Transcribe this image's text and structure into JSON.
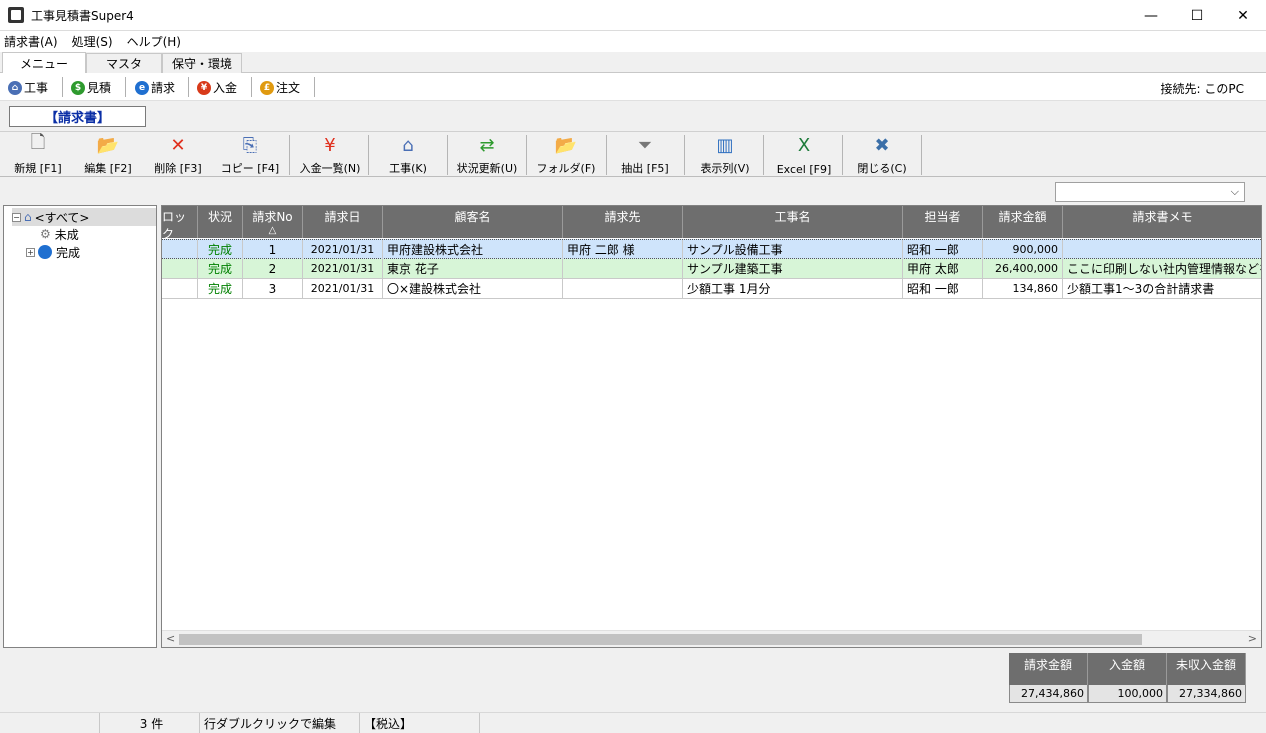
{
  "window": {
    "title": "工事見積書Super4",
    "minimize": "—",
    "maximize": "☐",
    "close": "✕"
  },
  "menu": [
    "請求書(A)",
    "処理(S)",
    "ヘルプ(H)"
  ],
  "tabs": [
    "メニュー",
    "マスタ",
    "保守・環境"
  ],
  "quick_nav": [
    {
      "label": "工事",
      "glyph": "⌂",
      "color": "#4a6fb5"
    },
    {
      "label": "見積",
      "glyph": "$",
      "color": "#2e9a2e"
    },
    {
      "label": "請求",
      "glyph": "e",
      "color": "#1f6fd0"
    },
    {
      "label": "入金",
      "glyph": "¥",
      "color": "#d83a1a"
    },
    {
      "label": "注文",
      "glyph": "£",
      "color": "#e09a10"
    }
  ],
  "connection": "接続先:  このPC",
  "section_title": "【請求書】",
  "toolbar": [
    {
      "label": "新規 [F1]",
      "glyph": "🗋",
      "color": "#555"
    },
    {
      "label": "編集 [F2]",
      "glyph": "📂",
      "color": "#d6a51a"
    },
    {
      "label": "削除 [F3]",
      "glyph": "✕",
      "color": "#e0301e"
    },
    {
      "label": "コピー [F4]",
      "glyph": "⎘",
      "color": "#4a6fb5"
    },
    {
      "label": "入金一覧(N)",
      "glyph": "¥",
      "color": "#e0301e"
    },
    {
      "label": "工事(K)",
      "glyph": "⌂",
      "color": "#4a6fb5"
    },
    {
      "label": "状況更新(U)",
      "glyph": "⇄",
      "color": "#2e9a2e"
    },
    {
      "label": "フォルダ(F)",
      "glyph": "📂",
      "color": "#d6a51a"
    },
    {
      "label": "抽出 [F5]",
      "glyph": "⏷",
      "color": "#777"
    },
    {
      "label": "表示列(V)",
      "glyph": "▥",
      "color": "#2e6fc0"
    },
    {
      "label": "Excel [F9]",
      "glyph": "X",
      "color": "#1d7b3a"
    },
    {
      "label": "閉じる(C)",
      "glyph": "✖",
      "color": "#3b6fa8"
    }
  ],
  "filter_combo": {
    "value": ""
  },
  "tree": [
    {
      "label": "<すべて>",
      "expander": "−",
      "selected": true
    },
    {
      "label": "未成",
      "expander": "",
      "selected": false
    },
    {
      "label": "完成",
      "expander": "+",
      "selected": false
    }
  ],
  "grid": {
    "columns": [
      {
        "label": "ロック",
        "sub": ""
      },
      {
        "label": "状況",
        "sub": ""
      },
      {
        "label": "請求No",
        "sub": "△"
      },
      {
        "label": "請求日",
        "sub": ""
      },
      {
        "label": "顧客名",
        "sub": ""
      },
      {
        "label": "請求先",
        "sub": ""
      },
      {
        "label": "工事名",
        "sub": ""
      },
      {
        "label": "担当者",
        "sub": ""
      },
      {
        "label": "請求金額",
        "sub": ""
      },
      {
        "label": "請求書メモ",
        "sub": ""
      }
    ],
    "rows": [
      {
        "lock": "",
        "status": "完成",
        "no": "1",
        "date": "2021/01/31",
        "customer": "甲府建設株式会社",
        "billto": "甲府  二郎  様",
        "project": "サンプル設備工事",
        "staff": "昭和  一郎",
        "amount": "900,000",
        "memo": ""
      },
      {
        "lock": "",
        "status": "完成",
        "no": "2",
        "date": "2021/01/31",
        "customer": "東京  花子",
        "billto": "",
        "project": "サンプル建築工事",
        "staff": "甲府  太郎",
        "amount": "26,400,000",
        "memo": "ここに印刷しない社内管理情報などを記"
      },
      {
        "lock": "",
        "status": "完成",
        "no": "3",
        "date": "2021/01/31",
        "customer": "〇×建設株式会社",
        "billto": "",
        "project": "少額工事  1月分",
        "staff": "昭和  一郎",
        "amount": "134,860",
        "memo": "少額工事1～3の合計請求書"
      }
    ]
  },
  "scroll": {
    "left": "<",
    "right": ">"
  },
  "totals": [
    {
      "label": "請求金額",
      "value": "27,434,860"
    },
    {
      "label": "入金額",
      "value": "100,000"
    },
    {
      "label": "未収入金額",
      "value": "27,334,860"
    }
  ],
  "status": {
    "count": "3 件",
    "hint": "行ダブルクリックで編集",
    "tax": "【税込】"
  }
}
